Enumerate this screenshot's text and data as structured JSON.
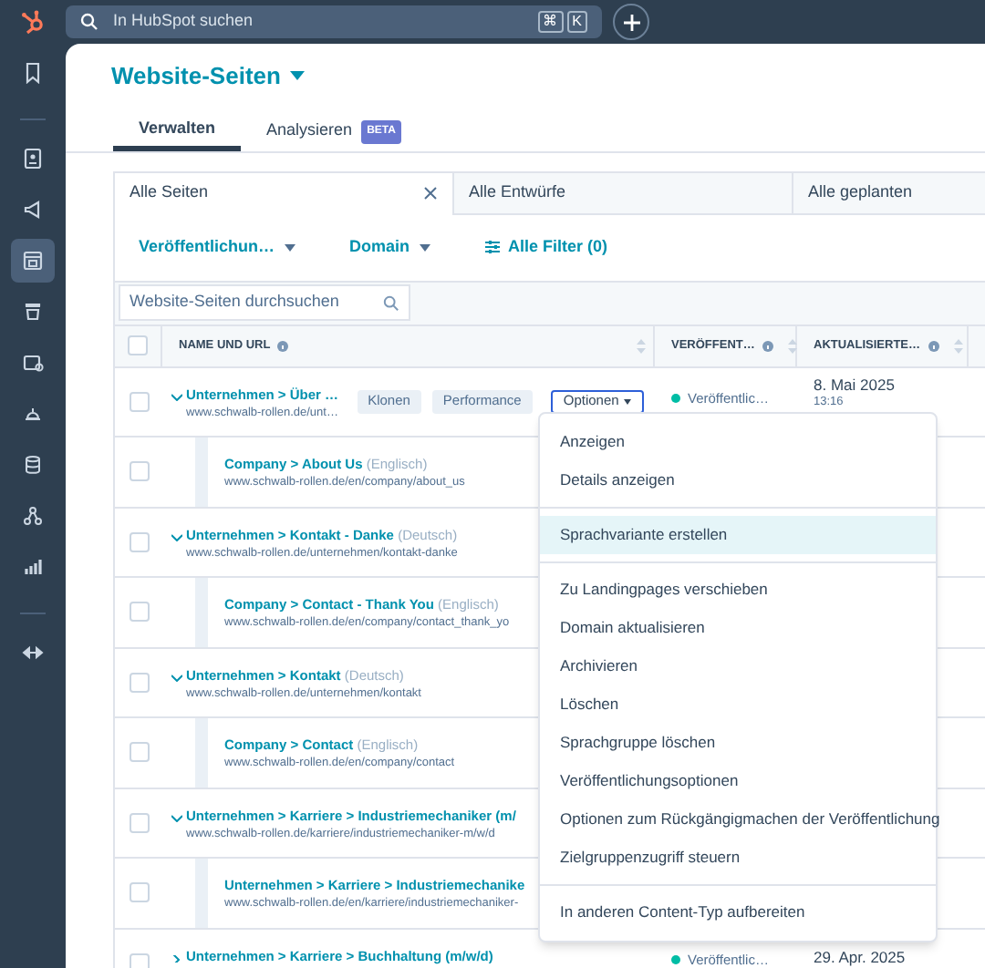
{
  "topbar": {
    "search_placeholder": "In HubSpot suchen",
    "shortcut_keys": [
      "⌘",
      "K"
    ]
  },
  "sidebar": {
    "items": [
      {
        "selected": false
      },
      {
        "selected": false
      },
      {
        "selected": false
      },
      {
        "selected": true
      },
      {
        "selected": false
      },
      {
        "selected": false
      },
      {
        "selected": false
      },
      {
        "selected": false
      },
      {
        "selected": false
      },
      {
        "selected": false
      },
      {
        "selected": false
      }
    ]
  },
  "page_title": "Website-Seiten",
  "tabs": [
    {
      "label": "Verwalten",
      "selected": true
    },
    {
      "label": "Analysieren",
      "selected": false,
      "badge": "BETA"
    }
  ],
  "views": [
    {
      "label": "Alle Seiten",
      "selected": true
    },
    {
      "label": "Alle Entwürfe",
      "selected": false
    },
    {
      "label": "Alle geplanten",
      "selected": false
    }
  ],
  "filters": [
    {
      "label": "Veröffentlichun…",
      "kind": "dropdown"
    },
    {
      "label": "Domain",
      "kind": "dropdown"
    },
    {
      "label": "Alle Filter (0)",
      "kind": "all"
    }
  ],
  "table_search": {
    "placeholder": "Website-Seiten durchsuchen"
  },
  "table": {
    "select_all": {
      "checked": false
    },
    "columns": [
      {
        "label": "NAME UND URL"
      },
      {
        "label": "VERÖFFENT…"
      },
      {
        "label": "AKTUALISIERTE…"
      }
    ],
    "rows": [
      {
        "kind": "parent",
        "checked": false,
        "expanded": true,
        "name": "Unternehmen > Über …",
        "url": "www.schwalb-rollen.de/unt…",
        "actions": [
          "Klonen",
          "Performance",
          "Optionen"
        ],
        "status": "Veröffentlic…",
        "color": "#00bda5",
        "updated": "8. Mai 2025",
        "time": "13:16"
      },
      {
        "kind": "child",
        "checked": false,
        "name": "Company > About Us",
        "language": "(Englisch)",
        "url": "www.schwalb-rollen.de/en/company/about_us"
      },
      {
        "kind": "parent",
        "checked": false,
        "expanded": true,
        "name": "Unternehmen > Kontakt - Danke",
        "language": "(Deutsch)",
        "url": "www.schwalb-rollen.de/unternehmen/kontakt-danke"
      },
      {
        "kind": "child",
        "checked": false,
        "name": "Company > Contact - Thank You",
        "language": "(Englisch)",
        "url": "www.schwalb-rollen.de/en/company/contact_thank_yo"
      },
      {
        "kind": "parent",
        "checked": false,
        "expanded": true,
        "name": "Unternehmen > Kontakt",
        "language": "(Deutsch)",
        "url": "www.schwalb-rollen.de/unternehmen/kontakt"
      },
      {
        "kind": "child",
        "checked": false,
        "name": "Company > Contact",
        "language": "(Englisch)",
        "url": "www.schwalb-rollen.de/en/company/contact"
      },
      {
        "kind": "parent",
        "checked": false,
        "expanded": true,
        "name": "Unternehmen > Karriere > Industriemechaniker (m/",
        "url": "www.schwalb-rollen.de/karriere/industriemechaniker-m/w/d"
      },
      {
        "kind": "child",
        "checked": false,
        "name": "Unternehmen > Karriere > Industriemechanike",
        "url": "www.schwalb-rollen.de/en/karriere/industriemechaniker-"
      },
      {
        "kind": "parent",
        "checked": false,
        "expanded": false,
        "name": "Unternehmen > Karriere > Buchhaltung (m/w/d)",
        "status": "Veröffentlic…",
        "color": "#00bda5",
        "updated": "29. Apr. 2025"
      }
    ]
  },
  "menu": {
    "groups": [
      [
        {
          "label": "Anzeigen",
          "selected": false
        },
        {
          "label": "Details anzeigen",
          "selected": false
        }
      ],
      [
        {
          "label": "Sprachvariante erstellen",
          "selected": true
        }
      ],
      [
        {
          "label": "Zu Landingpages verschieben",
          "selected": false
        },
        {
          "label": "Domain aktualisieren",
          "selected": false
        },
        {
          "label": "Archivieren",
          "selected": false
        },
        {
          "label": "Löschen",
          "selected": false
        },
        {
          "label": "Sprachgruppe löschen",
          "selected": false
        },
        {
          "label": "Veröffentlichungsoptionen",
          "selected": false
        },
        {
          "label": "Optionen zum Rückgängigmachen der Veröffentlichung",
          "selected": false
        },
        {
          "label": "Zielgruppenzugriff steuern",
          "selected": false
        }
      ],
      [
        {
          "label": "In anderen Content-Typ aufbereiten",
          "selected": false
        }
      ]
    ]
  }
}
